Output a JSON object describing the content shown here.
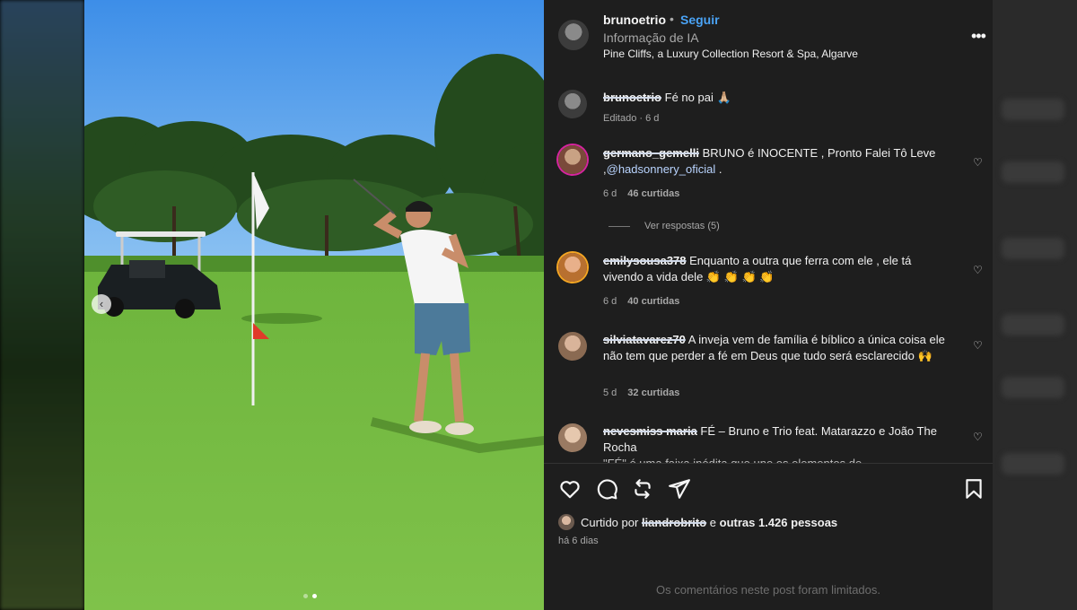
{
  "post": {
    "username": "brunoetrio",
    "separator": "•",
    "follow_label": "Seguir",
    "ai_info": "Informação de IA",
    "location": "Pine Cliffs, a Luxury Collection Resort & Spa, Algarve",
    "more_icon": "more-horizontal-icon",
    "carousel": {
      "total": 2,
      "active": 2
    }
  },
  "comments": [
    {
      "username": "brunoetrio",
      "text": "Fé no pai 🙏🏼",
      "meta": "Editado · 6 d",
      "likes": ""
    },
    {
      "username": "germano_gemelli",
      "text": "BRUNO é INOCENTE , Pronto Falei Tô Leve ,",
      "mention": "@hadsonnery_oficial",
      "tail": " .",
      "time": "6 d",
      "likes": "46 curtidas",
      "replies": "Ver respostas (5)"
    },
    {
      "username": "emilysousa378",
      "text": "Enquanto a outra que ferra com ele , ele tá vivendo a vida dele 👏 👏 👏 👏",
      "time": "6 d",
      "likes": "40 curtidas"
    },
    {
      "username": "silviatavarez70",
      "text": "A inveja vem de família é bíblico a única coisa ele não tem que perder a fé em Deus que tudo será esclarecido 🙌",
      "time": "5 d",
      "likes": "32 curtidas"
    },
    {
      "username": "nevesmiss maria",
      "text": "FÉ – Bruno e Trio feat. Matarazzo e João The Rocha",
      "partial": "\"FÉ\" é uma faixa inédita que une os elementos de"
    }
  ],
  "actions": {
    "like_icon": "heart-icon",
    "comment_icon": "comment-icon",
    "repost_icon": "repost-icon",
    "share_icon": "send-icon",
    "save_icon": "bookmark-icon"
  },
  "likes": {
    "prefix": "Curtido por",
    "name": "liandrobrito",
    "suffix_and": "e",
    "suffix_bold": "outras 1.426 pessoas"
  },
  "time_ago": "há 6 dias",
  "limited_notice": "Os comentários neste post foram limitados."
}
